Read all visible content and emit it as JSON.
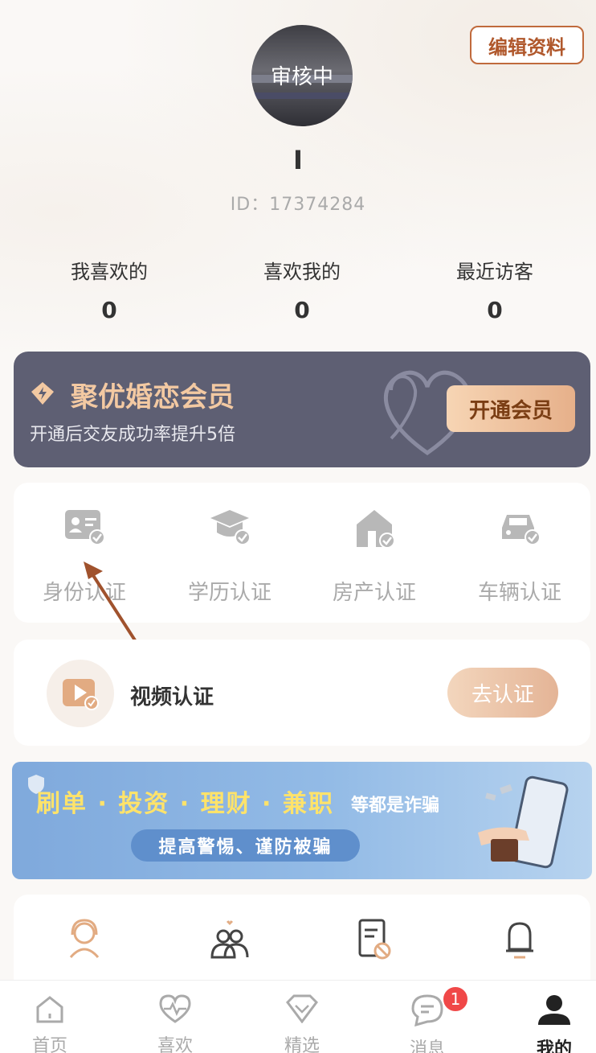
{
  "header": {
    "edit_profile": "编辑资料",
    "avatar_status": "审核中",
    "nickname": "I",
    "user_id": "ID：17374284"
  },
  "stats": [
    {
      "label": "我喜欢的",
      "value": "0"
    },
    {
      "label": "喜欢我的",
      "value": "0"
    },
    {
      "label": "最近访客",
      "value": "0"
    }
  ],
  "vip": {
    "title": "聚优婚恋会员",
    "subtitle": "开通后交友成功率提升5倍",
    "button": "开通会员"
  },
  "certifications": [
    {
      "label": "身份认证",
      "icon": "id-card-icon"
    },
    {
      "label": "学历认证",
      "icon": "graduation-cap-icon"
    },
    {
      "label": "房产认证",
      "icon": "house-icon"
    },
    {
      "label": "车辆认证",
      "icon": "car-icon"
    }
  ],
  "video_cert": {
    "label": "视频认证",
    "button": "去认证"
  },
  "banner": {
    "headline": "刷单 · 投资 · 理财 · 兼职",
    "tail": "等都是诈骗",
    "pill": "提高警惕、谨防被骗"
  },
  "tools": [
    "customer-service-icon",
    "matchmaker-icon",
    "blacklist-icon",
    "notification-bell-icon"
  ],
  "tabbar": [
    {
      "label": "首页",
      "icon": "home-icon"
    },
    {
      "label": "喜欢",
      "icon": "heart-pulse-icon"
    },
    {
      "label": "精选",
      "icon": "diamond-icon"
    },
    {
      "label": "消息",
      "icon": "message-icon",
      "badge": "1"
    },
    {
      "label": "我的",
      "icon": "profile-icon",
      "active": true
    }
  ],
  "colors": {
    "accent": "#c06a3c",
    "vip_bg": "#5e5f73",
    "vip_gold": "#f3c9a2",
    "banner_blue": "#93bbe6",
    "badge_red": "#f04848"
  }
}
